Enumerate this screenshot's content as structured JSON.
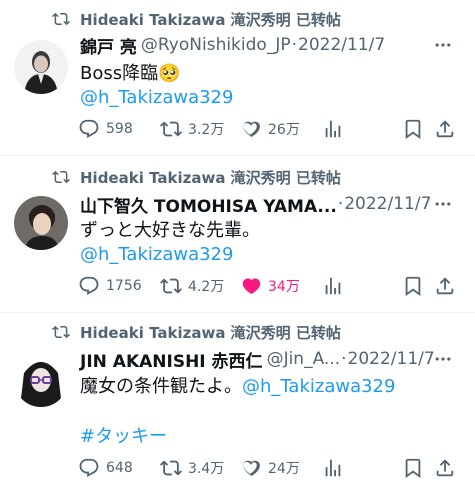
{
  "tweets": [
    {
      "retweeter": "Hideaki Takizawa 滝沢秀明 已转帖",
      "name": "錦戸 亮",
      "handle": "@RyoNishikido_JP",
      "date": "2022/11/7",
      "line1": "Boss降臨🥺",
      "line2": "@h_Takizawa329",
      "replies": "598",
      "retweets": "3.2万",
      "likes": "26万",
      "liked": false
    },
    {
      "retweeter": "Hideaki Takizawa 滝沢秀明 已转帖",
      "name": "山下智久 TOMOHISA YAMA...",
      "handle": "",
      "date": "2022/11/7",
      "line1": "ずっと大好きな先輩。",
      "line2": "@h_Takizawa329",
      "replies": "1756",
      "retweets": "4.2万",
      "likes": "34万",
      "liked": true
    },
    {
      "retweeter": "Hideaki Takizawa 滝沢秀明 已转帖",
      "name": "JIN AKANISHI 赤西仁",
      "handle": "@Jin_A...",
      "date": "2022/11/7",
      "line1_text": "魔女の条件観たよ。",
      "line1_mention": "@h_Takizawa329",
      "line2": "#タッキー",
      "replies": "648",
      "retweets": "3.4万",
      "likes": "24万",
      "liked": false
    }
  ],
  "colors": {
    "text": "#0f1419",
    "secondary": "#536471",
    "link": "#1d9bf0",
    "like": "#f91880",
    "divider": "#eff3f4"
  },
  "icons": [
    "retweet-icon",
    "more-icon",
    "reply-icon",
    "like-icon",
    "views-icon",
    "bookmark-icon",
    "share-icon"
  ]
}
